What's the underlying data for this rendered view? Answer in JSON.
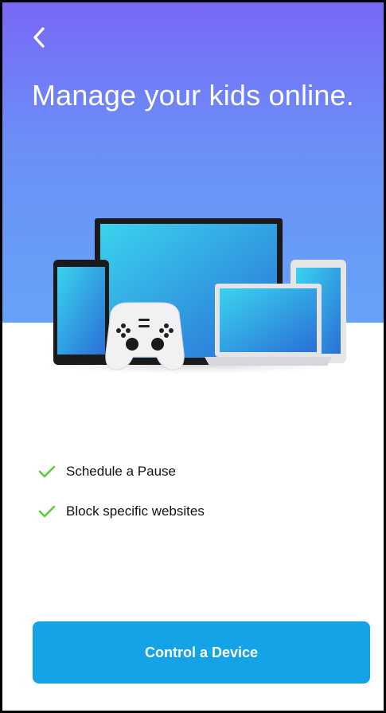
{
  "header": {
    "back_icon": "chevron-left-icon",
    "title": "Manage your kids online."
  },
  "illustration": {
    "icon": "devices-illustration-icon"
  },
  "features": {
    "check_icon": "checkmark-icon",
    "items": [
      {
        "label": "Schedule a Pause"
      },
      {
        "label": "Block specific websites"
      }
    ]
  },
  "actions": {
    "primary_label": "Control a Device"
  },
  "colors": {
    "hero_top": "#7868f6",
    "hero_bottom": "#65a3f7",
    "check_green": "#5ccb3d",
    "button_blue": "#14a3e6"
  }
}
